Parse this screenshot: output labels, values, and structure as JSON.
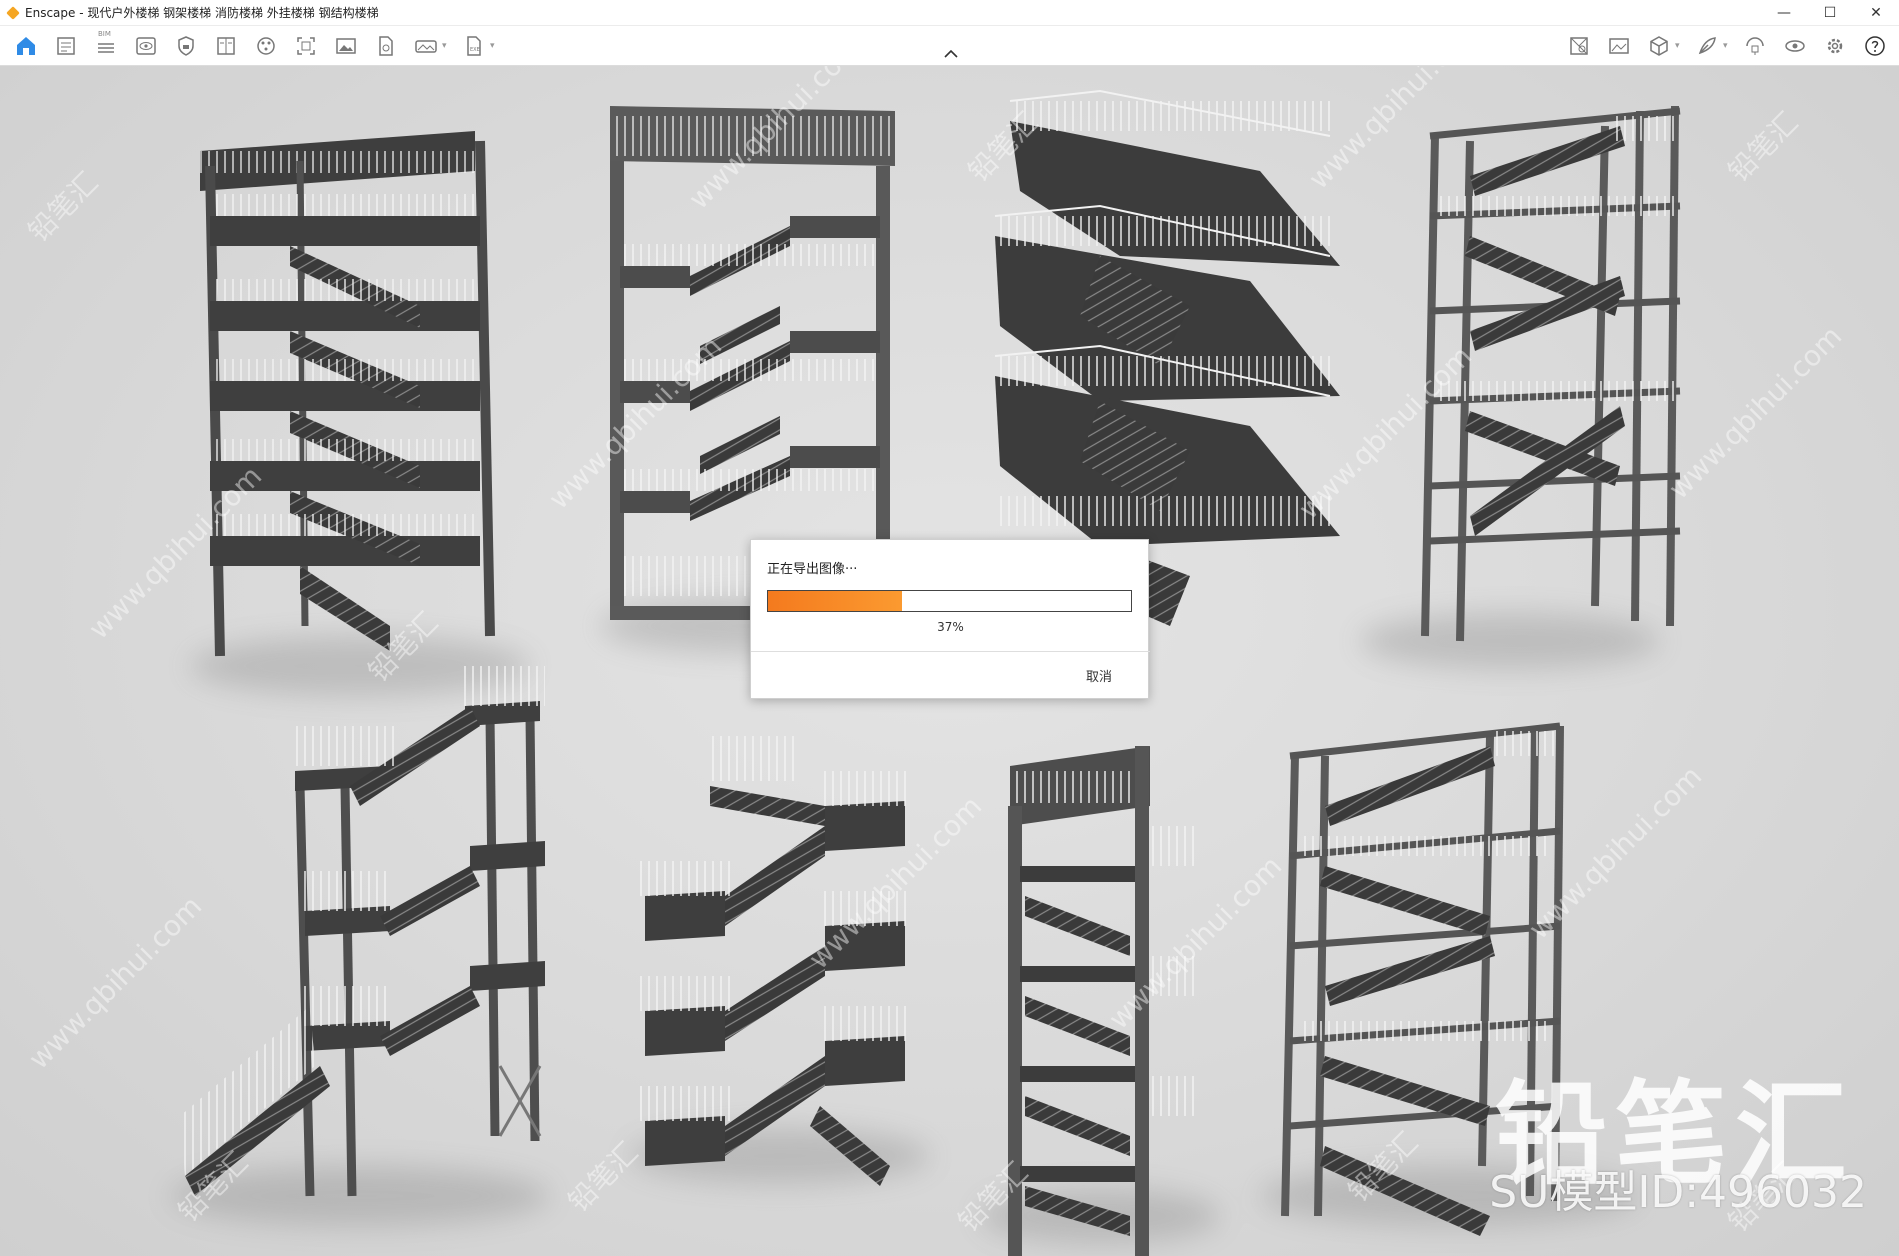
{
  "window": {
    "title": "Enscape - 现代户外楼梯 钢架楼梯 消防楼梯 外挂楼梯 钢结构楼梯",
    "minimize_glyph": "—",
    "maximize_glyph": "☐",
    "close_glyph": "✕"
  },
  "toolbar": {
    "bim_label": "BIM",
    "left_icons": [
      "home-icon",
      "document-icon",
      "list-icon",
      "eye-view-icon",
      "shield-icon",
      "book-icon",
      "palette-icon",
      "capture-icon",
      "image-icon",
      "file-icon",
      "panorama-icon",
      "exe-export-icon"
    ],
    "right_icons": [
      "asset-library-icon",
      "gallery-icon",
      "cube-icon",
      "feather-icon",
      "sync-icon",
      "visibility-icon",
      "settings-gear-icon",
      "help-icon"
    ]
  },
  "dialog": {
    "title": "正在导出图像···",
    "progress_fraction": 0.37,
    "progress_text": "37%",
    "cancel_label": "取消",
    "accent_color": "#f47a1e"
  },
  "watermark": {
    "brand": "铅笔汇",
    "model_id": "SU模型ID:496032",
    "tile_text": "www.qbihui.com",
    "tile_brand": "铅笔汇"
  }
}
